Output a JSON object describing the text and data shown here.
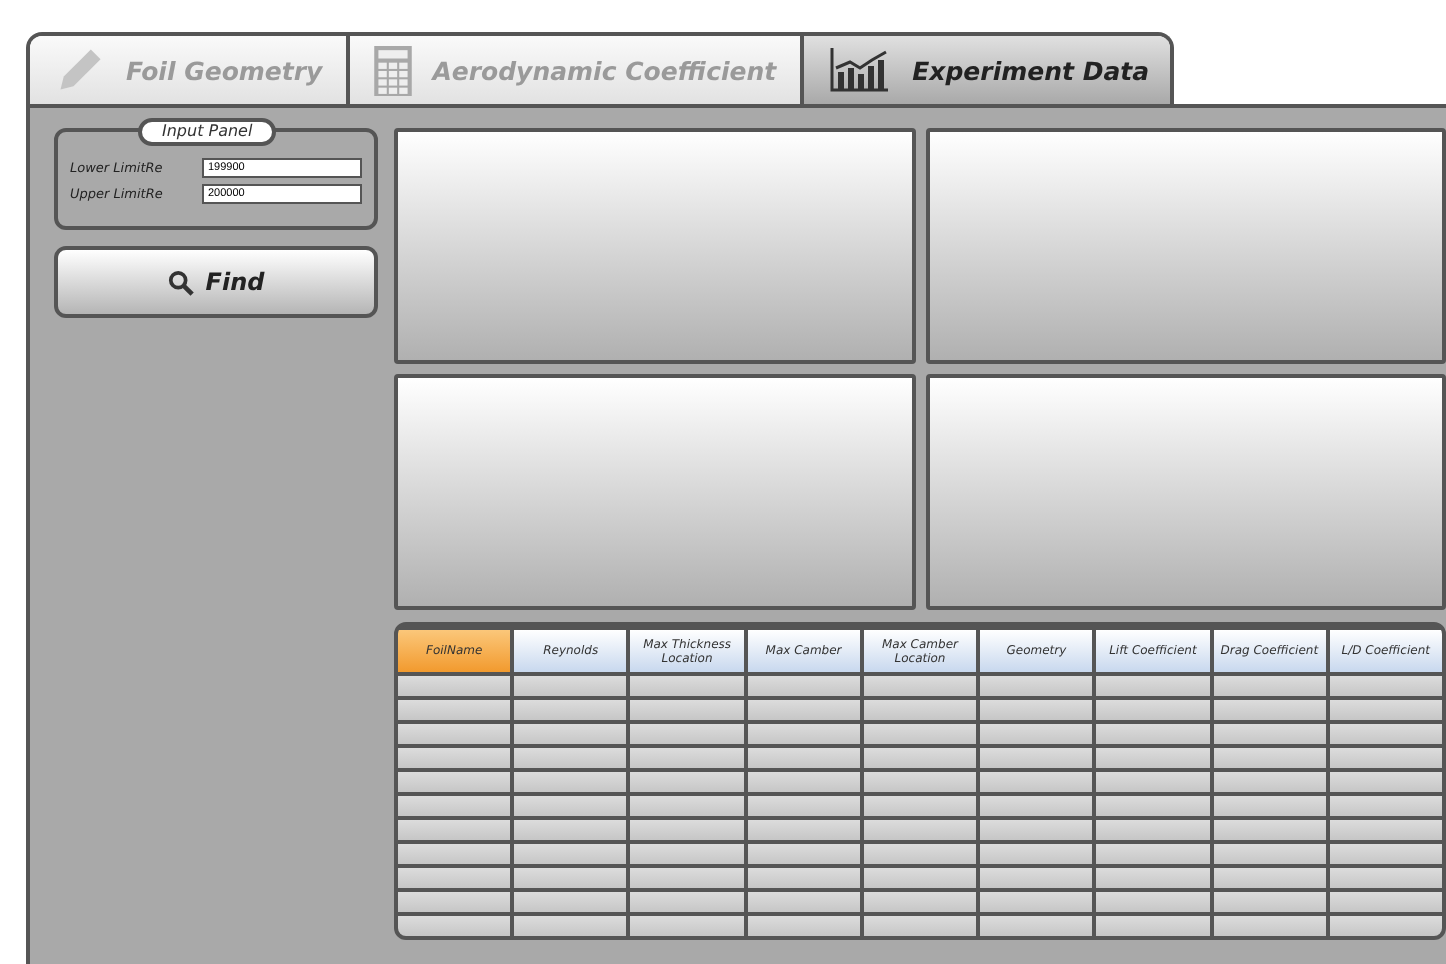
{
  "tabs": [
    {
      "label": "Foil Geometry",
      "selected": false
    },
    {
      "label": "Aerodynamic Coefficient",
      "selected": false
    },
    {
      "label": "Experiment Data",
      "selected": true
    }
  ],
  "input_panel": {
    "title": "Input Panel",
    "fields": [
      {
        "label": "Lower LimitRe",
        "value": "199900"
      },
      {
        "label": "Upper LimitRe",
        "value": "200000"
      }
    ]
  },
  "find_button": {
    "label": "Find"
  },
  "table": {
    "columns": [
      {
        "label": "FoilName",
        "selected": true
      },
      {
        "label": "Reynolds",
        "selected": false
      },
      {
        "label": "Max Thickness Location",
        "selected": false
      },
      {
        "label": "Max Camber",
        "selected": false
      },
      {
        "label": "Max Camber Location",
        "selected": false
      },
      {
        "label": "Geometry",
        "selected": false
      },
      {
        "label": "Lift Coefficient",
        "selected": false
      },
      {
        "label": "Drag Coefficient",
        "selected": false
      },
      {
        "label": "L/D Coefficient",
        "selected": false
      }
    ]
  }
}
